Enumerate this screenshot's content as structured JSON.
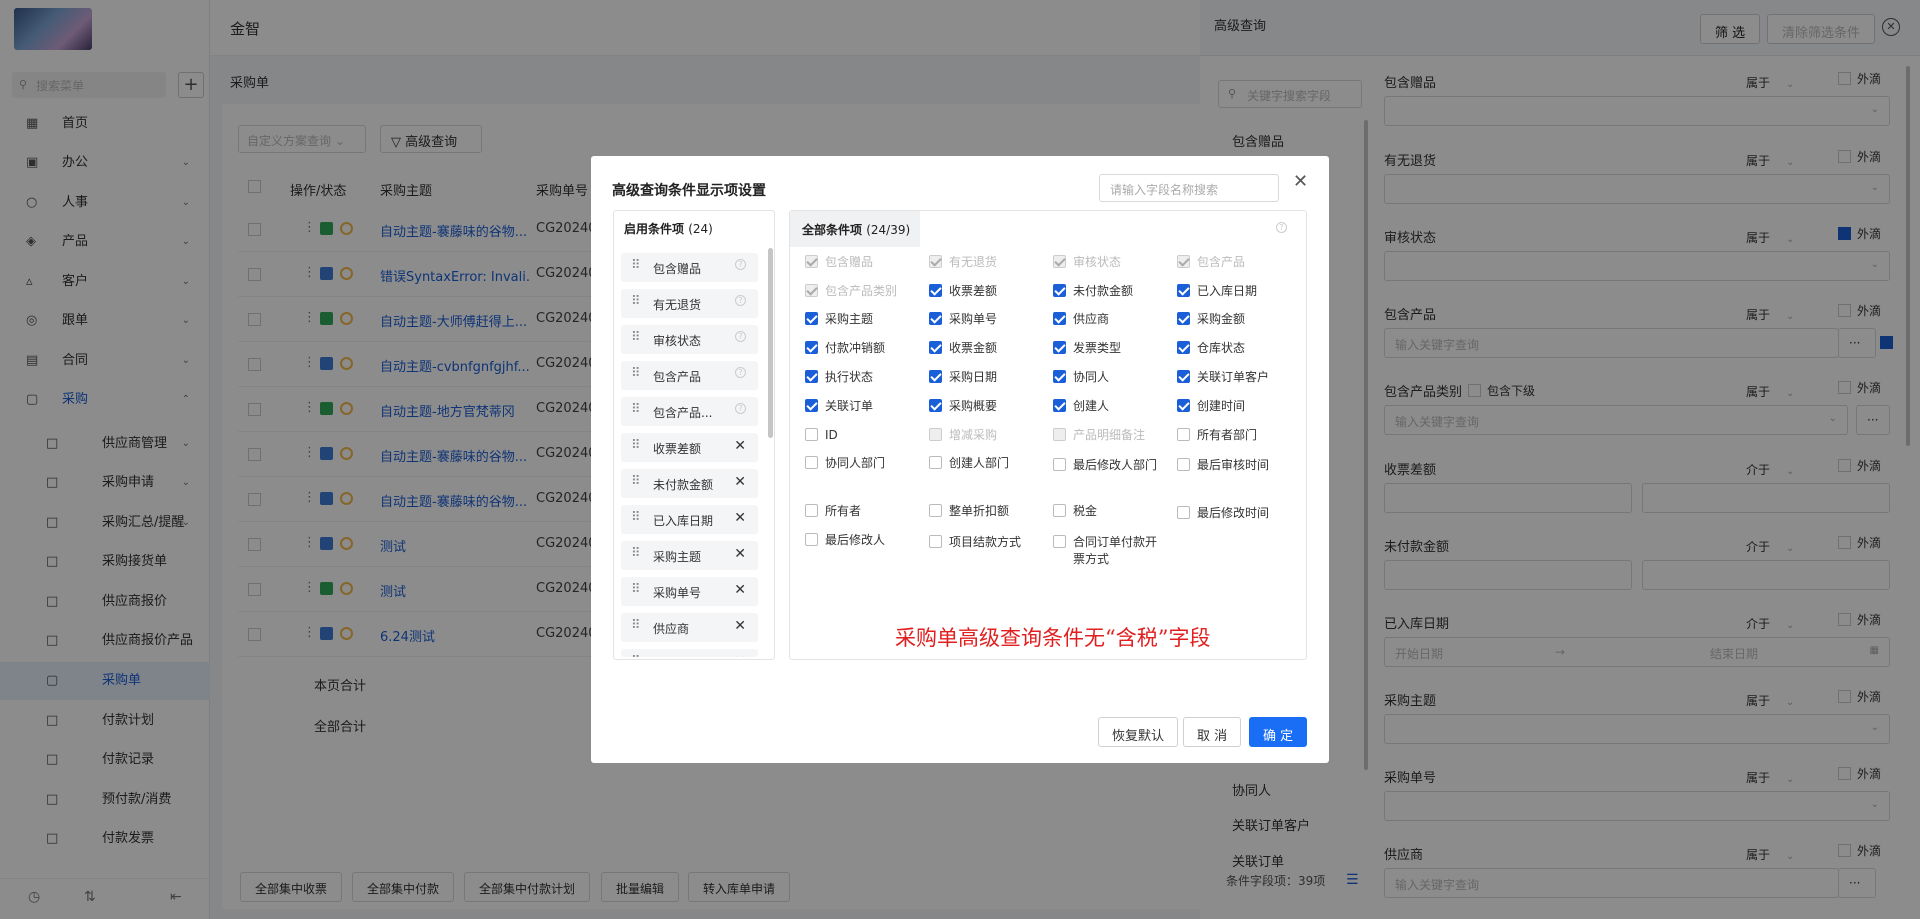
{
  "app": {
    "brand": "金智",
    "search_placeholder": "搜索菜单"
  },
  "sidebar": {
    "items": [
      {
        "label": "首页"
      },
      {
        "label": "办公"
      },
      {
        "label": "人事"
      },
      {
        "label": "产品"
      },
      {
        "label": "客户"
      },
      {
        "label": "跟单"
      },
      {
        "label": "合同"
      },
      {
        "label": "采购"
      }
    ],
    "sub_items": [
      {
        "label": "供应商管理"
      },
      {
        "label": "采购申请"
      },
      {
        "label": "采购汇总/提醒"
      },
      {
        "label": "采购接货单"
      },
      {
        "label": "供应商报价"
      },
      {
        "label": "供应商报价产品"
      },
      {
        "label": "采购单"
      },
      {
        "label": "付款计划"
      },
      {
        "label": "付款记录"
      },
      {
        "label": "预付款/消费"
      },
      {
        "label": "付款发票"
      }
    ]
  },
  "main": {
    "breadcrumb": "采购单",
    "view_select_placeholder": "自定义方案查询",
    "adv_query_label": "高级查询",
    "columns": {
      "op": "操作/状态",
      "subject": "采购主题",
      "number": "采购单号"
    },
    "rows": [
      {
        "subject": "自动主题-褰藤味的谷物...",
        "number": "CG202407"
      },
      {
        "subject": "错误SyntaxError: Invali...",
        "number": "CG202407"
      },
      {
        "subject": "自动主题-大师傅赶得上...",
        "number": "CG202406"
      },
      {
        "subject": "自动主题-cvbnfgnfgjhf...",
        "number": "CG202406"
      },
      {
        "subject": "自动主题-地方官梵蒂冈",
        "number": "CG202405"
      },
      {
        "subject": "自动主题-褰藤味的谷物...",
        "number": "CG202406"
      },
      {
        "subject": "自动主题-褰藤味的谷物...",
        "number": "CG202405"
      },
      {
        "subject": "测试",
        "number": "CG202406"
      },
      {
        "subject": "测试",
        "number": "CG202407"
      },
      {
        "subject": "6.24测试",
        "number": "CG202406"
      }
    ],
    "page_total": "本页合计",
    "all_total": "全部合计",
    "bottom_buttons": [
      "全部集中收票",
      "全部集中付款",
      "全部集中付款计划",
      "批量编辑",
      "转入库单申请"
    ]
  },
  "right_panel": {
    "title": "高级查询",
    "filter_btn": "筛 选",
    "clear_btn": "清除筛选条件",
    "field_search_placeholder": "关键字搜索字段",
    "field_list": [
      "包含赠品",
      "协同人",
      "关联订单客户",
      "关联订单"
    ],
    "field_count": "条件字段项：39项",
    "conditions": [
      {
        "label": "包含赠品",
        "op": "属于",
        "ex": "外滴",
        "placeholder": "",
        "exon": false
      },
      {
        "label": "有无退货",
        "op": "属于",
        "ex": "外滴",
        "placeholder": "",
        "exon": false
      },
      {
        "label": "审核状态",
        "op": "属于",
        "ex": "外滴",
        "placeholder": "",
        "exon": true
      },
      {
        "label": "包含产品",
        "op": "属于",
        "ex": "外滴",
        "placeholder": "输入关键字查询",
        "exon": false
      },
      {
        "label": "包含产品类别",
        "op": "属于",
        "ex": "外滴",
        "placeholder": "输入关键字查询",
        "exon": false
      },
      {
        "label": "收票差额",
        "op": "介于",
        "ex": "外滴",
        "placeholder": "",
        "exon": false
      },
      {
        "label": "未付款金额",
        "op": "介于",
        "ex": "外滴",
        "placeholder": "",
        "exon": false
      },
      {
        "label": "已入库日期",
        "op": "介于",
        "ex": "外滴",
        "placeholder": "",
        "exon": false
      },
      {
        "label": "采购主题",
        "op": "属于",
        "ex": "外滴",
        "placeholder": "",
        "exon": false
      },
      {
        "label": "采购单号",
        "op": "属于",
        "ex": "外滴",
        "placeholder": "",
        "exon": false
      },
      {
        "label": "供应商",
        "op": "属于",
        "ex": "外滴",
        "placeholder": "输入关键字查询",
        "exon": false
      }
    ],
    "include_sub": "包含下级",
    "date_start": "开始日期",
    "date_end": "结束日期"
  },
  "modal": {
    "title": "高级查询条件显示项设置",
    "search_placeholder": "请输入字段名称搜索",
    "enabled_title": "启用条件项",
    "enabled_count": "(24)",
    "enabled_items": [
      "包含赠品",
      "有无退货",
      "审核状态",
      "包含产品",
      "包含产品...",
      "收票差额",
      "未付款金额",
      "已入库日期",
      "采购主题",
      "采购单号",
      "供应商",
      "采购日期"
    ],
    "all_title": "全部条件项",
    "all_count": "(24/39)",
    "all_items": [
      [
        "包含赠品",
        "有无退货",
        "审核状态",
        "包含产品"
      ],
      [
        "包含产品类别",
        "收票差额",
        "未付款金额",
        "已入库日期"
      ],
      [
        "采购主题",
        "采购单号",
        "供应商",
        "采购金额"
      ],
      [
        "付款冲销额",
        "收票金额",
        "发票类型",
        "仓库状态"
      ],
      [
        "执行状态",
        "采购日期",
        "协同人",
        "关联订单客户"
      ],
      [
        "关联订单",
        "采购概要",
        "创建人",
        "创建时间"
      ],
      [
        "ID",
        "增减采购",
        "产品明细备注",
        "所有者部门"
      ],
      [
        "协同人部门",
        "创建人部门",
        "最后修改人部门",
        "最后审核时间"
      ],
      [
        "所有者",
        "整单折扣额",
        "税金",
        "最后修改时间"
      ],
      [
        "最后修改人",
        "项目结款方式",
        "合同订单付款开票方式",
        ""
      ]
    ],
    "note": "采购单高级查询条件无“含税”字段",
    "reset_label": "恢复默认",
    "cancel_label": "取 消",
    "confirm_label": "确 定"
  }
}
